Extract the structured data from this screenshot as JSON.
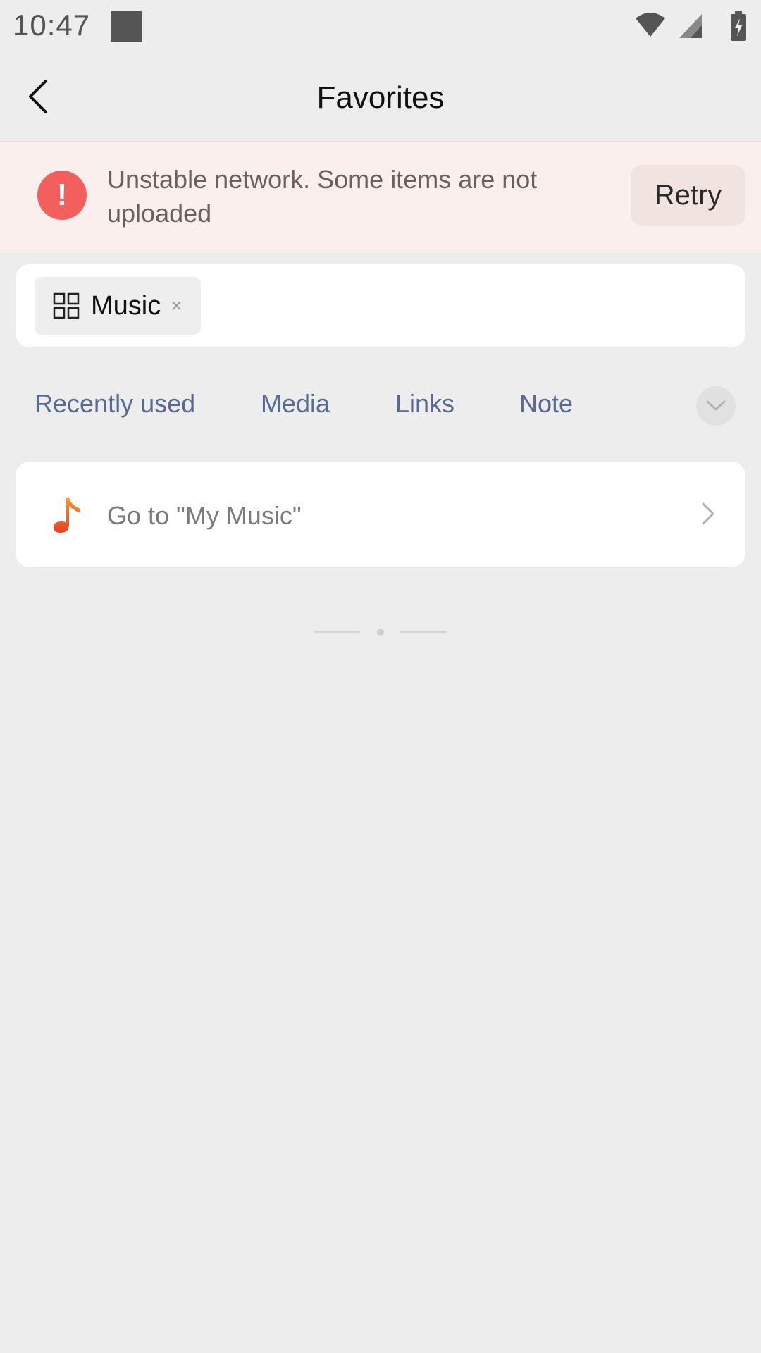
{
  "status_bar": {
    "time": "10:47",
    "icons": [
      "notification-square-icon",
      "wifi-icon",
      "signal-icon",
      "battery-charging-icon"
    ]
  },
  "header": {
    "title": "Favorites",
    "back_icon": "back-chevron-icon"
  },
  "banner": {
    "message": "Unstable network. Some items are not uploaded",
    "icon": "alert-icon",
    "retry_label": "Retry",
    "accent_color": "#f25f5c"
  },
  "tag_filter": {
    "chip_label": "Music",
    "chip_icon": "grid-icon",
    "chip_close": "×"
  },
  "tabs": [
    {
      "label": "Recently used"
    },
    {
      "label": "Media"
    },
    {
      "label": "Links"
    },
    {
      "label": "Note"
    }
  ],
  "more_icon": "chevron-down-icon",
  "music_item": {
    "label": "Go to \"My Music\"",
    "icon": "music-note-icon"
  },
  "colors": {
    "background": "#ededed",
    "link": "#576b95",
    "banner_bg": "#fbefed"
  }
}
